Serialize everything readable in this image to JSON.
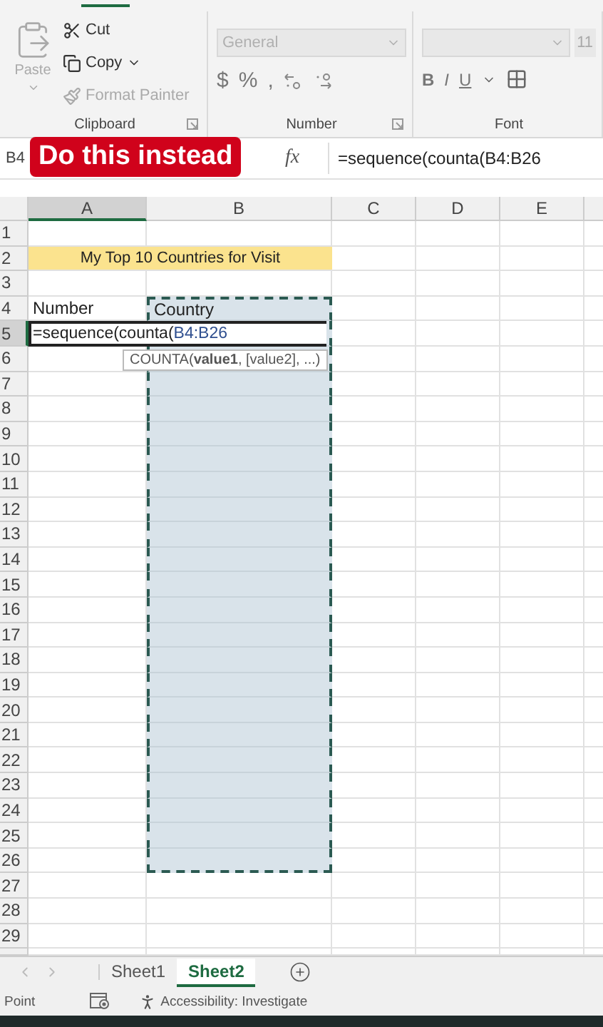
{
  "clipboard": {
    "label": "Clipboard",
    "paste": {
      "label": "Paste",
      "disabled": true
    },
    "actions": [
      {
        "kind": "cut",
        "label": "Cut",
        "disabled": false
      },
      {
        "kind": "copy",
        "label": "Copy",
        "disabled": false
      },
      {
        "kind": "painter",
        "label": "Format Painter",
        "disabled": true
      }
    ]
  },
  "number": {
    "label": "Number",
    "format": {
      "value": "General",
      "disabled": true
    },
    "symbols": [
      "$",
      "%",
      ","
    ]
  },
  "font": {
    "label": "Font",
    "size": "11",
    "styles": [
      "B",
      "I",
      "U"
    ]
  },
  "caption": "Do this instead",
  "formula_bar": {
    "name_box": "B4",
    "function_label": "fx",
    "formula": "=sequence(counta(B4:B26"
  },
  "columns": [
    {
      "label": "A",
      "selected": true
    },
    {
      "label": "B",
      "selected": false
    },
    {
      "label": "C",
      "selected": false
    },
    {
      "label": "D",
      "selected": false
    },
    {
      "label": "E",
      "selected": false
    }
  ],
  "rows": [
    {
      "label": "1",
      "selected": false,
      "marquee": false
    },
    {
      "label": "2",
      "selected": false,
      "marquee": false,
      "cells": [
        {
          "kind": "title",
          "text": "My Top 10 Countries for Visit"
        }
      ]
    },
    {
      "label": "3",
      "selected": false,
      "marquee": false
    },
    {
      "label": "4",
      "selected": false,
      "marquee": true,
      "cells": [
        {
          "kind": "text",
          "text": "Number"
        },
        {
          "kind": "text",
          "text": "Country"
        }
      ]
    },
    {
      "label": "5",
      "selected": true,
      "marquee": true,
      "cells": [
        {
          "kind": "editing",
          "text": "=sequence(counta(",
          "reference": "B4:B26",
          "hint": "COUNTA(**value1**, [value2], ...)"
        }
      ]
    },
    {
      "label": "6",
      "selected": false,
      "marquee": true
    },
    {
      "label": "7",
      "selected": false,
      "marquee": true
    },
    {
      "label": "8",
      "selected": false,
      "marquee": true
    },
    {
      "label": "9",
      "selected": false,
      "marquee": true
    },
    {
      "label": "10",
      "selected": false,
      "marquee": true
    },
    {
      "label": "11",
      "selected": false,
      "marquee": true
    },
    {
      "label": "12",
      "selected": false,
      "marquee": true
    },
    {
      "label": "13",
      "selected": false,
      "marquee": true
    },
    {
      "label": "14",
      "selected": false,
      "marquee": true
    },
    {
      "label": "15",
      "selected": false,
      "marquee": true
    },
    {
      "label": "16",
      "selected": false,
      "marquee": true
    },
    {
      "label": "17",
      "selected": false,
      "marquee": true
    },
    {
      "label": "18",
      "selected": false,
      "marquee": true
    },
    {
      "label": "19",
      "selected": false,
      "marquee": true
    },
    {
      "label": "20",
      "selected": false,
      "marquee": true
    },
    {
      "label": "21",
      "selected": false,
      "marquee": true
    },
    {
      "label": "22",
      "selected": false,
      "marquee": true
    },
    {
      "label": "23",
      "selected": false,
      "marquee": true
    },
    {
      "label": "24",
      "selected": false,
      "marquee": true
    },
    {
      "label": "25",
      "selected": false,
      "marquee": true
    },
    {
      "label": "26",
      "selected": false,
      "marquee": true
    },
    {
      "label": "27",
      "selected": false,
      "marquee": false
    },
    {
      "label": "28",
      "selected": false,
      "marquee": false
    },
    {
      "label": "29",
      "selected": false,
      "marquee": false
    }
  ],
  "sheet_tabs": [
    {
      "label": "Sheet1",
      "selected": false
    },
    {
      "label": "Sheet2",
      "selected": true
    }
  ],
  "status_bar": {
    "mode": "Point",
    "accessibility": "Accessibility: Investigate"
  }
}
